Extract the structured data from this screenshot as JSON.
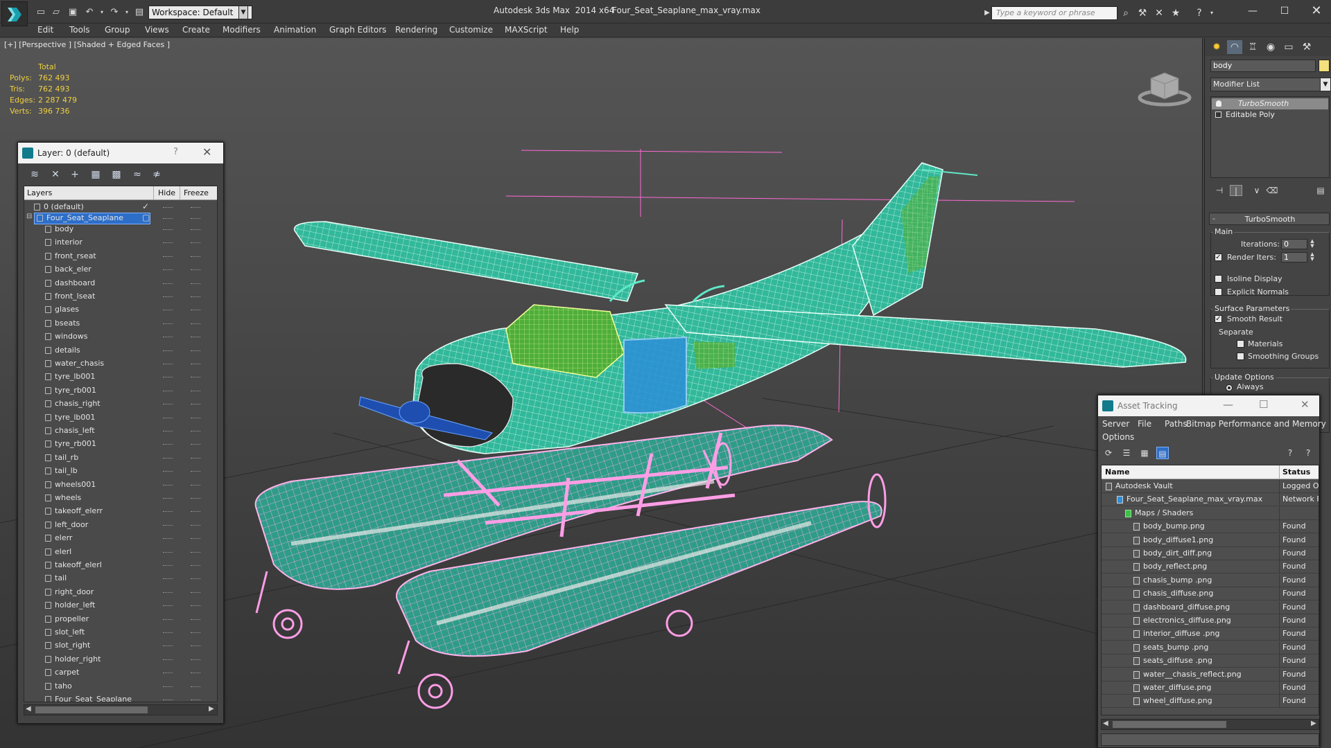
{
  "titlebar": {
    "workspace": "Workspace: Default",
    "app_title": "Autodesk 3ds Max  2014 x64",
    "file_title": "Four_Seat_Seaplane_max_vray.max",
    "search_placeholder": "Type a keyword or phrase"
  },
  "menu": [
    "Edit",
    "Tools",
    "Group",
    "Views",
    "Create",
    "Modifiers",
    "Animation",
    "Graph Editors",
    "Rendering",
    "Customize",
    "MAXScript",
    "Help"
  ],
  "viewport": {
    "label": "[+] [Perspective ] [Shaded + Edged Faces ]",
    "stats": {
      "header": "Total",
      "rows": [
        {
          "label": "Polys:",
          "value": "762 493"
        },
        {
          "label": "Tris:",
          "value": "762 493"
        },
        {
          "label": "Edges:",
          "value": "2 287 479"
        },
        {
          "label": "Verts:",
          "value": "396 736"
        }
      ]
    }
  },
  "layer_window": {
    "title": "Layer: 0 (default)",
    "help": "?",
    "columns": {
      "layers": "Layers",
      "hide": "Hide",
      "freeze": "Freeze"
    },
    "default_layer": "0 (default)",
    "selected_layer": "Four_Seat_Seaplane",
    "objects": [
      "body",
      "interior",
      "front_rseat",
      "back_eler",
      "dashboard",
      "front_lseat",
      "glases",
      "bseats",
      "windows",
      "details",
      "water_chasis",
      "tyre_lb001",
      "tyre_rb001",
      "chasis_right",
      "tyre_lb001",
      "chasis_left",
      "tyre_rb001",
      "tail_rb",
      "tail_lb",
      "wheels001",
      "wheels",
      "takeoff_elerr",
      "left_door",
      "elerr",
      "elerl",
      "takeoff_elerl",
      "tail",
      "right_door",
      "holder_left",
      "propeller",
      "slot_left",
      "slot_right",
      "holder_right",
      "carpet",
      "taho",
      "Four_Seat_Seaplane"
    ]
  },
  "command_panel": {
    "object_name": "body",
    "object_color": "#f4e07c",
    "modifier_list": "Modifier List",
    "stack": [
      "TurboSmooth",
      "Editable Poly"
    ],
    "turbosmooth": {
      "title": "TurboSmooth",
      "main": "Main",
      "iterations_label": "Iterations:",
      "iterations": "0",
      "render_iters_label": "Render Iters:",
      "render_iters": "1",
      "render_iters_checked": true,
      "isoline_label": "Isoline Display",
      "isoline_checked": false,
      "explicit_normals_label": "Explicit Normals",
      "explicit_normals_checked": false,
      "surface_params": "Surface Parameters",
      "smooth_result_label": "Smooth Result",
      "smooth_result_checked": true,
      "separate": "Separate",
      "materials_label": "Materials",
      "materials_checked": false,
      "smoothing_groups_label": "Smoothing Groups",
      "smoothing_groups_checked": false,
      "update_options": "Update Options",
      "always_label": "Always"
    }
  },
  "asset_tracking": {
    "title": "Asset Tracking",
    "menu": [
      "Server",
      "File",
      "Paths",
      "Bitmap Performance and Memory",
      "Options"
    ],
    "columns": {
      "name": "Name",
      "status": "Status"
    },
    "rows": [
      {
        "name": "Autodesk Vault",
        "status": "Logged Out",
        "level": 0
      },
      {
        "name": "Four_Seat_Seaplane_max_vray.max",
        "status": "Network Path",
        "level": 1
      },
      {
        "name": "Maps / Shaders",
        "status": "",
        "level": 2
      },
      {
        "name": "body_bump.png",
        "status": "Found",
        "level": 3
      },
      {
        "name": "body_diffuse1.png",
        "status": "Found",
        "level": 3
      },
      {
        "name": "body_dirt_diff.png",
        "status": "Found",
        "level": 3
      },
      {
        "name": "body_reflect.png",
        "status": "Found",
        "level": 3
      },
      {
        "name": "chasis_bump .png",
        "status": "Found",
        "level": 3
      },
      {
        "name": "chasis_diffuse.png",
        "status": "Found",
        "level": 3
      },
      {
        "name": "dashboard_diffuse.png",
        "status": "Found",
        "level": 3
      },
      {
        "name": "electronics_diffuse.png",
        "status": "Found",
        "level": 3
      },
      {
        "name": "interior_diffuse .png",
        "status": "Found",
        "level": 3
      },
      {
        "name": "seats_bump .png",
        "status": "Found",
        "level": 3
      },
      {
        "name": "seats_diffuse .png",
        "status": "Found",
        "level": 3
      },
      {
        "name": "water__chasis_reflect.png",
        "status": "Found",
        "level": 3
      },
      {
        "name": "water_diffuse.png",
        "status": "Found",
        "level": 3
      },
      {
        "name": "wheel_diffuse.png",
        "status": "Found",
        "level": 3
      }
    ]
  },
  "colors": {
    "wire_teal": "#3fc7a8",
    "wire_pink": "#ff9ee6",
    "selection_blue": "#2d6ec8",
    "stats_yellow": "#f0d040"
  }
}
